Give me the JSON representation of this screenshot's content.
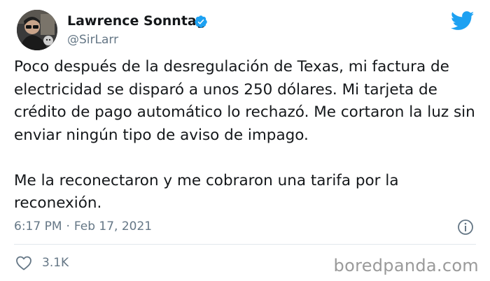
{
  "author": {
    "display_name": "Lawrence Sonntag",
    "handle": "@SirLarr",
    "verified": true
  },
  "tweet": {
    "paragraphs": [
      "Poco después de la desregulación de Texas, mi factura de electricidad se disparó a unos 250 dólares. Mi tarjeta de crédito de pago automático lo rechazó. Me cortaron la luz sin enviar ningún tipo de aviso de impago.",
      "Me la reconectaron y me cobraron una tarifa por la reconexión."
    ],
    "time": "6:17 PM",
    "separator": "·",
    "date": "Feb 17, 2021",
    "like_count": "3.1K"
  },
  "watermark": "boredpanda.com",
  "colors": {
    "twitter_blue": "#1da1f2",
    "text": "#14171a",
    "muted": "#657786",
    "divider": "#e1e8ed"
  },
  "icons": {
    "verified": "verified-badge-icon",
    "logo": "twitter-bird-icon",
    "info": "info-icon",
    "like": "heart-icon"
  }
}
